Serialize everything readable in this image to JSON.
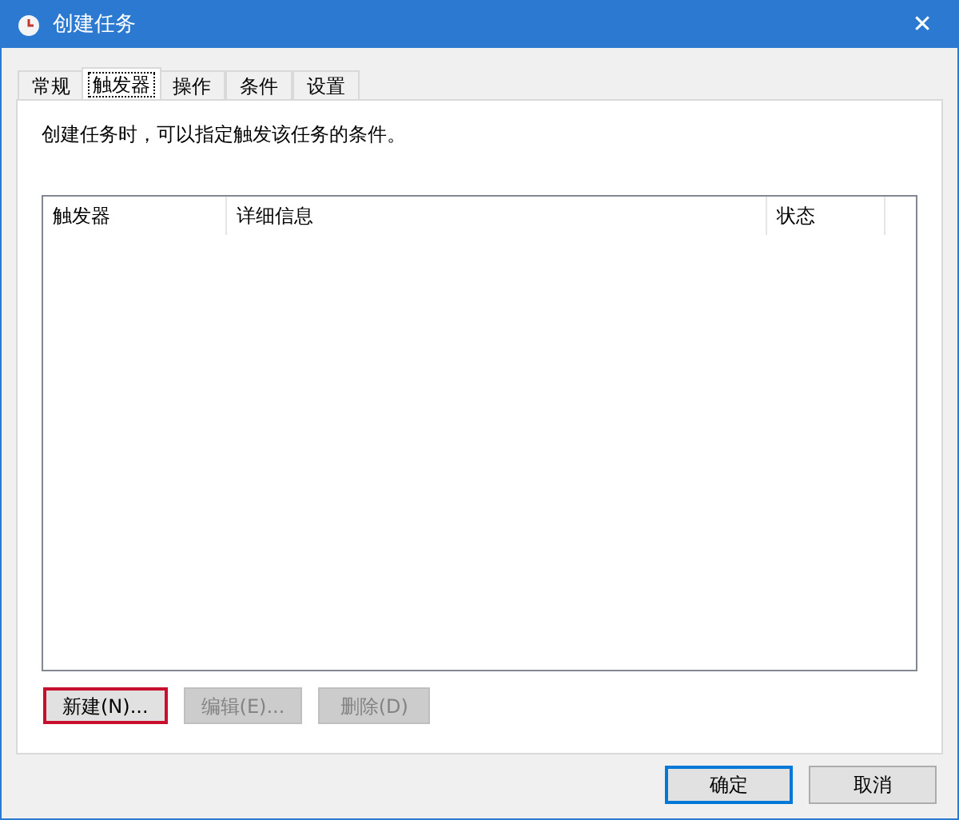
{
  "window": {
    "title": "创建任务",
    "close": "✕"
  },
  "tabs": [
    {
      "label": "常规",
      "selected": false
    },
    {
      "label": "触发器",
      "selected": true
    },
    {
      "label": "操作",
      "selected": false
    },
    {
      "label": "条件",
      "selected": false
    },
    {
      "label": "设置",
      "selected": false
    }
  ],
  "description": "创建任务时，可以指定触发该任务的条件。",
  "list": {
    "columns": [
      "触发器",
      "详细信息",
      "状态"
    ]
  },
  "list_buttons": [
    {
      "label": "新建(N)...",
      "disabled": false,
      "highlighted": true
    },
    {
      "label": "编辑(E)...",
      "disabled": true,
      "highlighted": false
    },
    {
      "label": "删除(D)",
      "disabled": true,
      "highlighted": false
    }
  ],
  "dialog_buttons": [
    {
      "label": "确定",
      "default": true
    },
    {
      "label": "取消",
      "default": false
    }
  ]
}
